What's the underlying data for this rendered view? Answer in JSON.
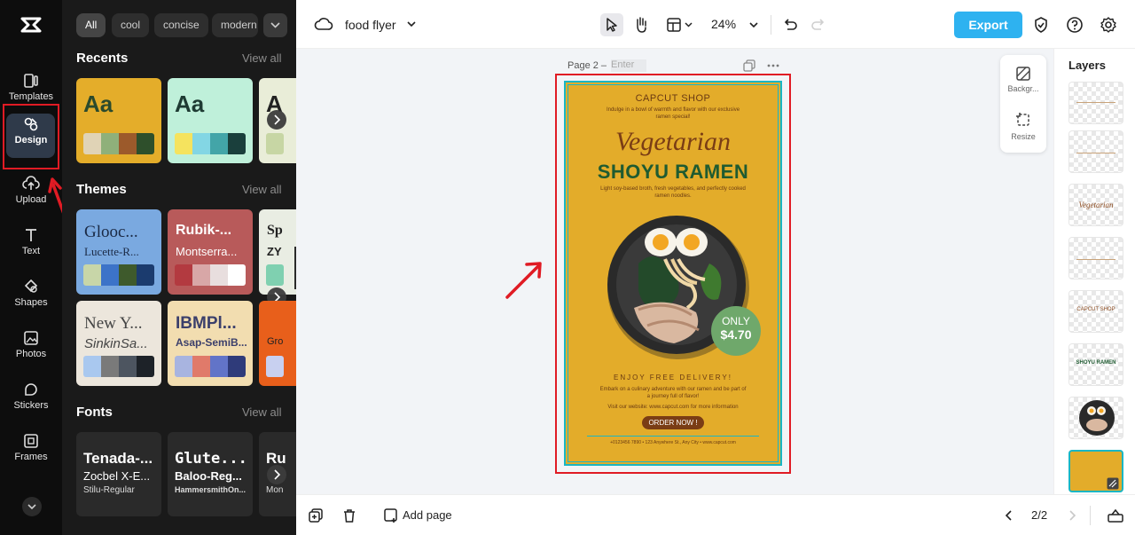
{
  "app": {
    "logo": "capcut-logo"
  },
  "rail": {
    "items": [
      {
        "label": "Templates",
        "icon": "templates-icon"
      },
      {
        "label": "Design",
        "icon": "design-icon",
        "active": true
      },
      {
        "label": "Upload",
        "icon": "upload-icon"
      },
      {
        "label": "Text",
        "icon": "text-icon"
      },
      {
        "label": "Shapes",
        "icon": "shapes-icon"
      },
      {
        "label": "Photos",
        "icon": "photos-icon"
      },
      {
        "label": "Stickers",
        "icon": "stickers-icon"
      },
      {
        "label": "Frames",
        "icon": "frames-icon"
      }
    ]
  },
  "panel": {
    "chips": [
      "All",
      "cool",
      "concise",
      "modern"
    ],
    "recents": {
      "title": "Recents",
      "view_all": "View all",
      "cards": [
        {
          "text": "Aa",
          "bg": "#e4ad2a",
          "fg": "#2b4a2c",
          "colors": [
            "#e0d3b6",
            "#8fb07a",
            "#9c5a2b",
            "#2e4f2b"
          ]
        },
        {
          "text": "Aa",
          "bg": "#bff0da",
          "fg": "#1e3b33",
          "colors": [
            "#f5e35e",
            "#83d6e4",
            "#43a5a8",
            "#1a3f3c"
          ]
        },
        {
          "text": "A",
          "bg": "#e9edd8",
          "fg": "#222",
          "colors": [
            "#c7d6a4"
          ]
        }
      ]
    },
    "themes": {
      "title": "Themes",
      "view_all": "View all",
      "cards": [
        {
          "t1": "Glooc...",
          "t2": "Lucette-R...",
          "bg": "#7aa9e0",
          "fg": "#1b2a45",
          "colors": [
            "#c8d6a8",
            "#3c73c8",
            "#3e5a2c",
            "#1b3b6e"
          ]
        },
        {
          "t1": "Rubik-...",
          "t2": "Montserra...",
          "bg": "#b85a5a",
          "fg": "#ffffff",
          "colors": [
            "#b33a40",
            "#d8a7a7",
            "#e8dede",
            "#ffffff"
          ]
        },
        {
          "t1": "Sp",
          "t2": "ZY",
          "bg": "#e9ede3",
          "fg": "#222",
          "colors": [
            "#7fd0b0"
          ]
        },
        {
          "t1": "New Y...",
          "t2": "SinkinSa...",
          "bg": "#ece6dc",
          "fg": "#444",
          "colors": [
            "#a9c8ef",
            "#7a7a7a",
            "#4d5560",
            "#1d2228"
          ]
        },
        {
          "t1": "IBMPl...",
          "t2": "Asap-SemiB...",
          "bg": "#f2ddb0",
          "fg": "#3b3f6b",
          "colors": [
            "#a8b4e0",
            "#e07a6a",
            "#6274c8",
            "#2f3b7a"
          ]
        },
        {
          "t1": "",
          "t2": "Gro",
          "bg": "#e85f1b",
          "fg": "#222",
          "colors": [
            "#c8d0f0"
          ]
        }
      ]
    },
    "fonts": {
      "title": "Fonts",
      "view_all": "View all",
      "cards": [
        {
          "a": "Tenada-...",
          "b": "Zocbel X-E...",
          "c": "Stilu-Regular"
        },
        {
          "a": "Glute...",
          "b": "Baloo-Reg...",
          "c": "HammersmithOn..."
        },
        {
          "a": "Ru",
          "b": "",
          "c": "Mon"
        }
      ]
    }
  },
  "topbar": {
    "title": "food flyer",
    "zoom": "24%",
    "export_label": "Export"
  },
  "canvas": {
    "page_label": "Page 2 –",
    "page_title_placeholder": "Enter",
    "side_tools": [
      "Backgr...",
      "Resize"
    ]
  },
  "poster": {
    "shop": "CAPCUT SHOP",
    "tagline": "Indulge in a bowl of warmth and flavor with our exclusive ramen special!",
    "title_script": "Vegetarian",
    "title_main": "SHOYU RAMEN",
    "desc": "Light soy-based broth, fresh vegetables, and perfectly cooked ramen noodles.",
    "price_label": "ONLY",
    "price": "$4.70",
    "delivery": "ENJOY FREE DELIVERY!",
    "order_note": "Embark on a culinary adventure with our ramen and be part of a journey full of flavor!",
    "visit": "Visit our website: www.capcut.com for more information",
    "order_btn": "ORDER NOW !",
    "contact": "+0123456 7890 • 123 Anywhere St., Any City • www.capcut.com",
    "colors": {
      "bg": "#e3ac2a",
      "border": "#19b6c4",
      "brown": "#7a3d15",
      "green": "#1f5b31"
    }
  },
  "layers": {
    "title": "Layers",
    "thumbs": [
      {
        "text": "",
        "color": "#a06a3a"
      },
      {
        "text": "",
        "color": "#a06a3a"
      },
      {
        "text": "Vegetarian",
        "color": "#8b4a1e"
      },
      {
        "text": "",
        "color": "#a06a3a"
      },
      {
        "text": "CAPCUT SHOP",
        "color": "#8b4a1e"
      },
      {
        "text": "SHOYU RAMEN",
        "color": "#1f5b31"
      },
      {
        "text": "",
        "color": "#333"
      },
      {
        "text": "",
        "color": "#e3ac2a"
      }
    ]
  },
  "bottombar": {
    "add_page": "Add page",
    "pager": "2/2"
  },
  "colors": {
    "accent": "#2eb2f0",
    "annotation": "#e01b24"
  }
}
